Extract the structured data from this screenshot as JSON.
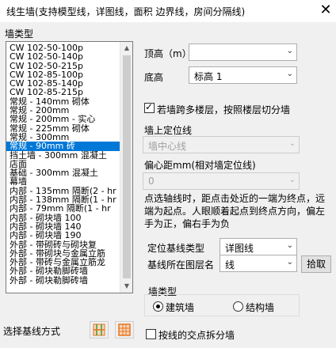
{
  "window": {
    "title": "线生墙(支持模型线，详图线，面积 边界线，房间分隔线)",
    "close_glyph": "✕"
  },
  "wall_type_group": {
    "label": "墙类型"
  },
  "wall_list": {
    "items": [
      "CW 102-50-100p",
      "CW 102-50-140p",
      "CW 102-50-215p",
      "CW 102-85-100p",
      "CW 102-85-140p",
      "CW 102-85-215p",
      "常规 - 140mm 砌体",
      "常规 - 200mm",
      "常规 - 200mm - 实心",
      "常规 - 225mm 砌体",
      "常规 - 300mm",
      "常规 - 90mm 砖",
      "挡土墙 - 300mm 混凝土",
      "店面",
      "基础 - 300mm 混凝土",
      "幕墙",
      "内部 - 135mm 隔断(2 - hr",
      "内部 - 138mm 隔断(1 - hr",
      "内部 - 79mm 隔断(1 - hr",
      "内部 - 砌块墙 100",
      "内部 - 砌块墙 140",
      "内部 - 砌块墙 190",
      "外部 - 带砌砖与砌块复",
      "外部 - 带砌块与金属立筋",
      "外部 - 带砖与金属立筋龙",
      "外部 - 砌块勒脚砖墙",
      "外部 - 砌块勒脚砖墙"
    ],
    "selected_index": 11,
    "scroll_up": "▲",
    "scroll_down": "▼"
  },
  "top_height": {
    "label": "顶高（m）",
    "value": "",
    "arrow": "⌄"
  },
  "base_height": {
    "label": "底高",
    "value": "标高 1",
    "arrow": "⌄"
  },
  "multi_level": {
    "label": "若墙跨多楼层，按照楼层切分墙",
    "checked": true
  },
  "location_line": {
    "label": "墙上定位线",
    "value": "墙中心线",
    "arrow": "⌄"
  },
  "offset": {
    "label": "偏心距mm(相对墙定位线)",
    "value": "0",
    "arrow": "⌄"
  },
  "note": "点选轴线时，距点击处近的一端为终点，远端为起点。人眼顺着起点到终点方向，偏左手为正，偏右手为负",
  "base_line_type": {
    "label": "定位基线类型",
    "value": "详图线",
    "arrow": "⌄"
  },
  "base_line_layer": {
    "label": "基线所在图层名",
    "value": "线",
    "arrow": "⌄",
    "pick_label": "拾取"
  },
  "wall_category": {
    "label": "墙类型",
    "options": [
      "建筑墙",
      "结构墙"
    ],
    "selected": "建筑墙"
  },
  "select_mode": {
    "label": "选择基线方式"
  },
  "split_at_intersection": {
    "label": "按线的交点拆分墙",
    "checked": false
  },
  "colors": {
    "selection": "#0078d7",
    "icon_orange": "#e8731b",
    "icon_green": "#3a9c3a"
  }
}
